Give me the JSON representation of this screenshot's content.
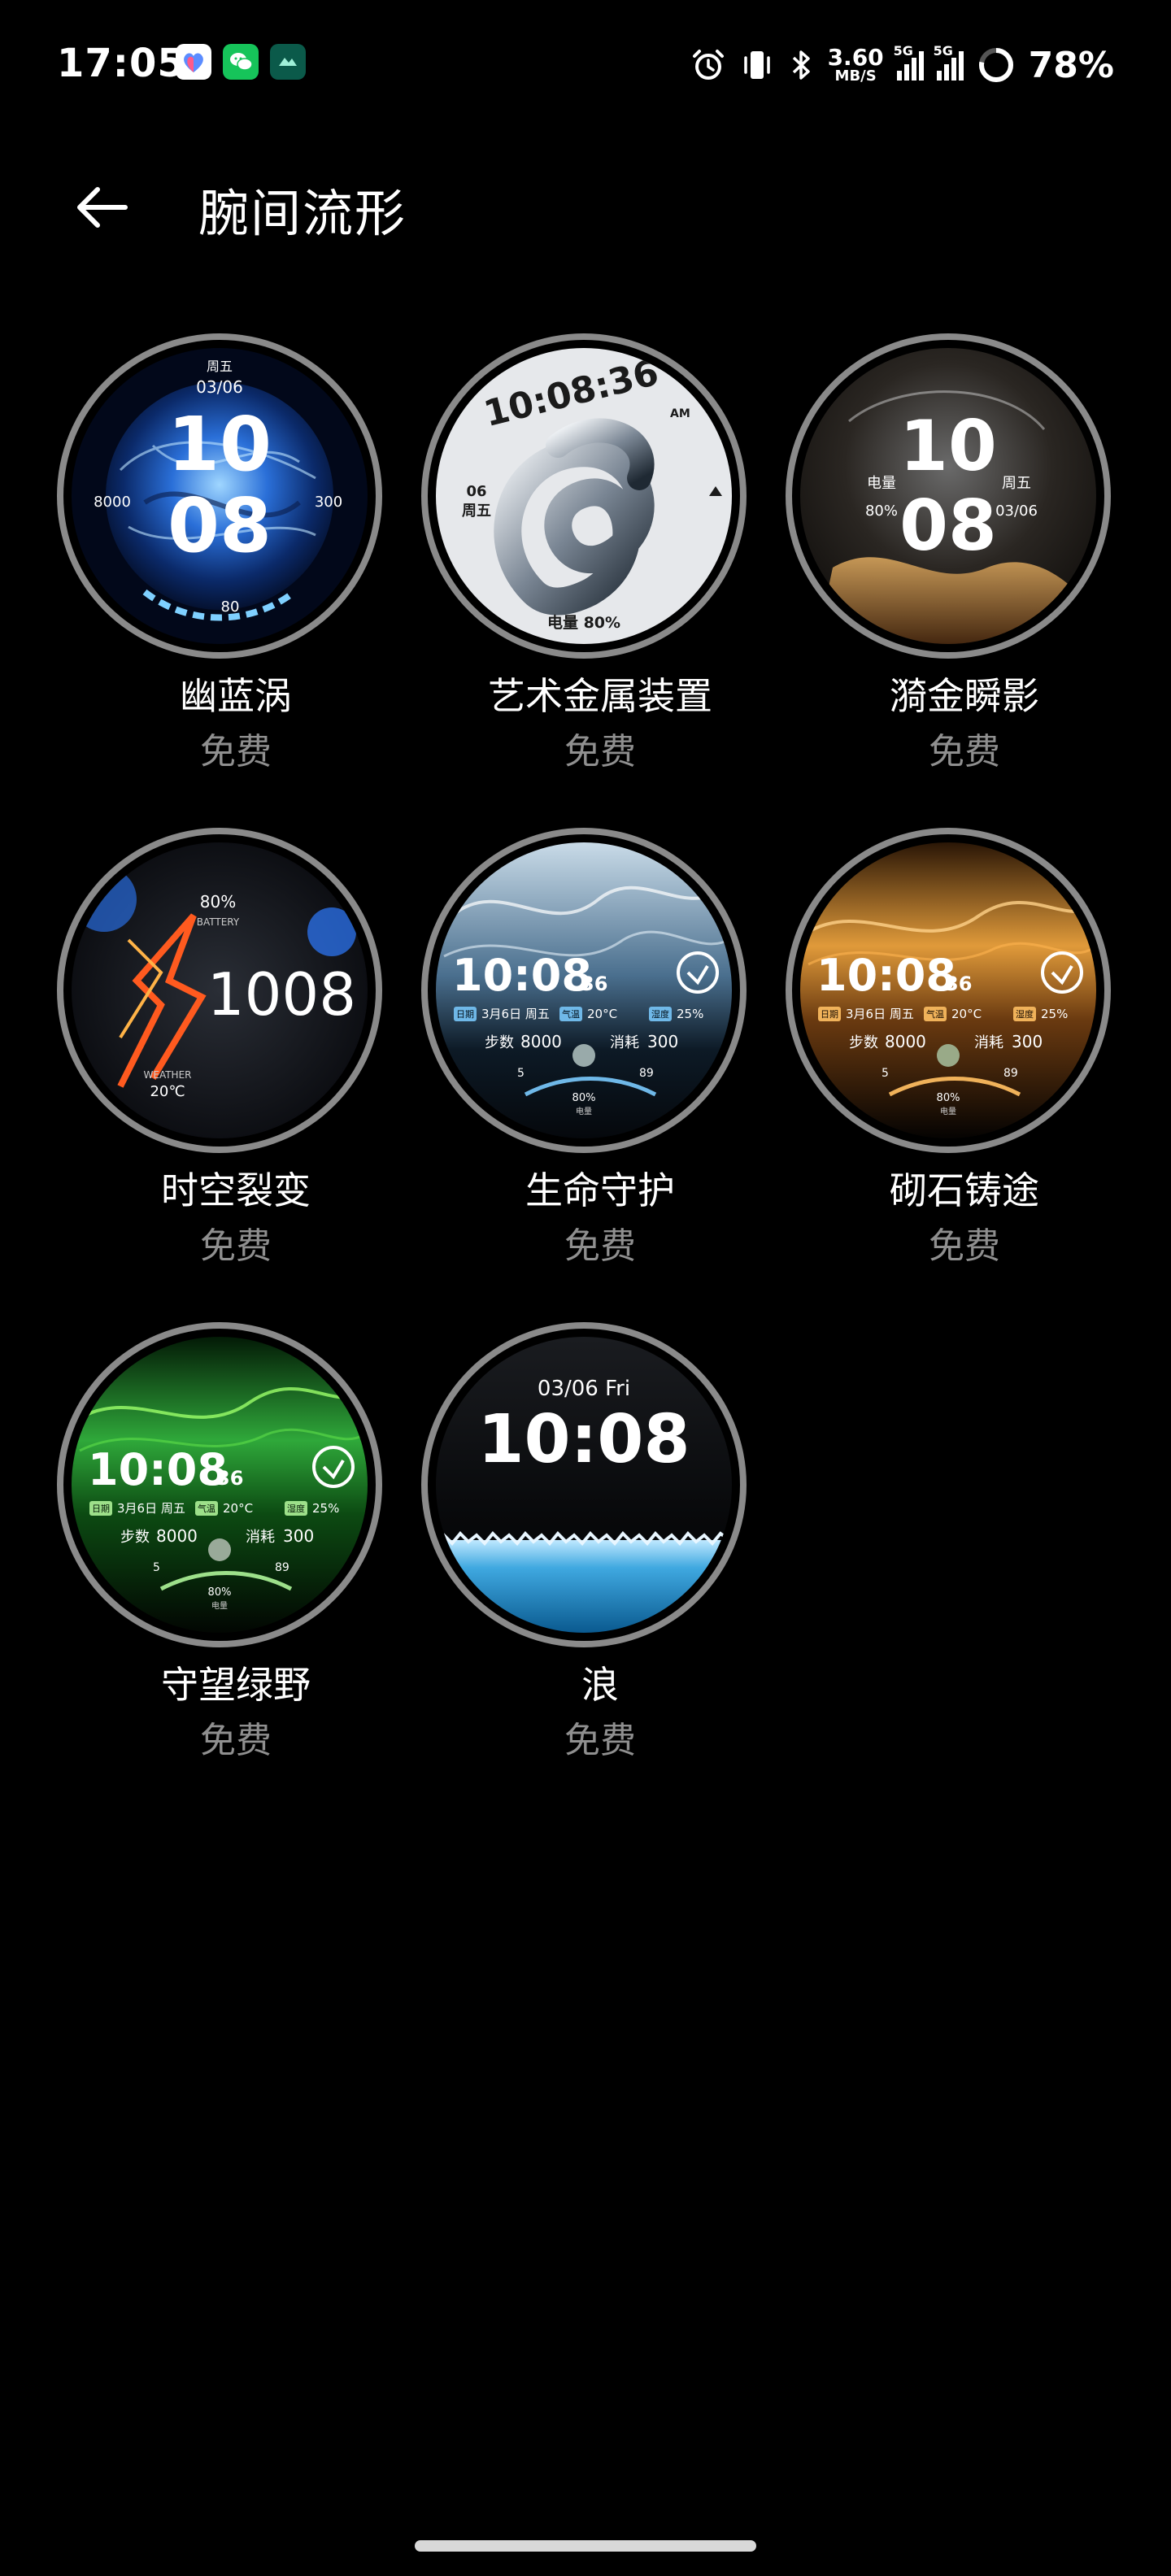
{
  "status_bar": {
    "time": "17:05",
    "notification_icons": [
      "health-app-icon",
      "wechat-icon",
      "app-notification-icon"
    ],
    "network_speed_value": "3.60",
    "network_speed_unit": "MB/S",
    "signal1_label": "5G",
    "signal2_label": "5G",
    "battery_percent": "78%",
    "battery_level": 0.78
  },
  "header": {
    "title": "腕间流形"
  },
  "watch_faces": [
    {
      "name": "幽蓝涡",
      "price": "免费",
      "texts": {
        "weekday": "周五",
        "date": "03/06",
        "hour": "10",
        "minute": "08",
        "left": "8000",
        "right": "300",
        "bottom": "80"
      }
    },
    {
      "name": "艺术金属装置",
      "price": "免费",
      "texts": {
        "time": "10:08:36",
        "ampm": "AM",
        "day": "06",
        "weekday": "周五",
        "battery": "电量 80%"
      }
    },
    {
      "name": "漪金瞬影",
      "price": "免费",
      "texts": {
        "hour": "10",
        "minute": "08",
        "left_label": "电量",
        "left_value": "80%",
        "right_label": "周五",
        "right_value": "03/06"
      }
    },
    {
      "name": "时空裂变",
      "price": "免费",
      "texts": {
        "battery_value": "80%",
        "battery_label": "BATTERY",
        "time": "1008",
        "weather_label": "WEATHER",
        "weather_value": "20℃"
      }
    },
    {
      "name": "生命守护",
      "price": "免费",
      "texts": {
        "time": "10:08",
        "seconds": "36",
        "date_tag": "日期",
        "date": "3月6日 周五",
        "temp_tag": "气温",
        "temp": "20°C",
        "hum_tag": "湿度",
        "hum": "25%",
        "steps_label": "步数",
        "steps": "8000",
        "cal_label": "消耗",
        "cal": "300",
        "uv": "5",
        "heart": "89",
        "batt": "80%",
        "batt_label": "电量"
      }
    },
    {
      "name": "砌石铸途",
      "price": "免费",
      "texts": {
        "time": "10:08",
        "seconds": "36",
        "date_tag": "日期",
        "date": "3月6日 周五",
        "temp_tag": "气温",
        "temp": "20°C",
        "hum_tag": "湿度",
        "hum": "25%",
        "steps_label": "步数",
        "steps": "8000",
        "cal_label": "消耗",
        "cal": "300",
        "uv": "5",
        "heart": "89",
        "batt": "80%",
        "batt_label": "电量"
      }
    },
    {
      "name": "守望绿野",
      "price": "免费",
      "texts": {
        "time": "10:08",
        "seconds": "36",
        "date_tag": "日期",
        "date": "3月6日 周五",
        "temp_tag": "气温",
        "temp": "20°C",
        "hum_tag": "湿度",
        "hum": "25%",
        "steps_label": "步数",
        "steps": "8000",
        "cal_label": "消耗",
        "cal": "300",
        "uv": "5",
        "heart": "89",
        "batt": "80%",
        "batt_label": "电量"
      }
    },
    {
      "name": "浪",
      "price": "免费",
      "texts": {
        "date": "03/06 Fri",
        "time": "10:08"
      }
    }
  ],
  "colors": {
    "background": "#000000",
    "title_text": "#ffffff",
    "price_text": "#8f8f8f",
    "ring": "#8a8a8a"
  }
}
